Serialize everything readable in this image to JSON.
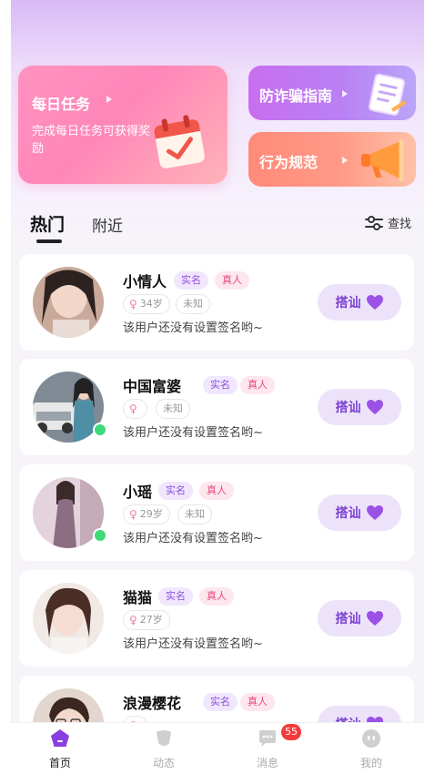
{
  "banners": {
    "daily_task": {
      "title": "每日任务",
      "desc": "完成每日任务可获得奖励"
    },
    "anti_fraud": {
      "title": "防诈骗指南"
    },
    "behavior": {
      "title": "行为规范"
    }
  },
  "tabs": {
    "hot": "热门",
    "nearby": "附近",
    "filter": "查找"
  },
  "users": [
    {
      "name": "小情人",
      "badge_real": "实名",
      "badge_true": "真人",
      "age": "34岁",
      "location": "未知",
      "signature": "该用户还没有设置签名哟~",
      "online": false
    },
    {
      "name": "中国富婆",
      "badge_real": "实名",
      "badge_true": "真人",
      "age": "",
      "location": "未知",
      "signature": "该用户还没有设置签名哟~",
      "online": true
    },
    {
      "name": "小瑶",
      "badge_real": "实名",
      "badge_true": "真人",
      "age": "29岁",
      "location": "未知",
      "signature": "该用户还没有设置签名哟~",
      "online": true
    },
    {
      "name": "猫猫",
      "badge_real": "实名",
      "badge_true": "真人",
      "age": "27岁",
      "location": "",
      "signature": "该用户还没有设置签名哟~",
      "online": false
    },
    {
      "name": "浪漫樱花",
      "badge_real": "实名",
      "badge_true": "真人",
      "age": "",
      "location": "",
      "signature": "",
      "online": false
    }
  ],
  "greet_label": "搭讪",
  "bottom_nav": {
    "home": "首页",
    "moments": "动态",
    "messages": "消息",
    "mine": "我的",
    "unread": "55"
  },
  "colors": {
    "accent_purple": "#7c3fd4",
    "online_green": "#3fd97a",
    "badge_red": "#f43b3b"
  }
}
